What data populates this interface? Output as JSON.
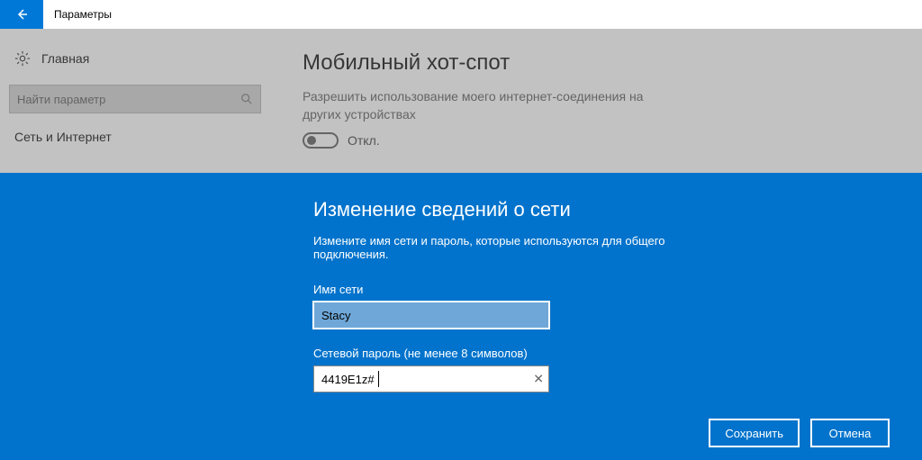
{
  "titlebar": {
    "title": "Параметры"
  },
  "sidebar": {
    "home_label": "Главная",
    "search_placeholder": "Найти параметр",
    "section_heading": "Сеть и Интернет"
  },
  "content": {
    "page_title": "Мобильный хот-спот",
    "description": "Разрешить использование моего интернет-соединения на других устройствах",
    "toggle_state": "Откл."
  },
  "modal": {
    "title": "Изменение сведений о сети",
    "subtitle": "Измените имя сети и пароль, которые используются для общего подключения.",
    "network_name_label": "Имя сети",
    "network_name_value": "Stacy",
    "password_label": "Сетевой пароль (не менее 8 символов)",
    "password_value": "4419E1z#",
    "save_label": "Сохранить",
    "cancel_label": "Отмена"
  }
}
